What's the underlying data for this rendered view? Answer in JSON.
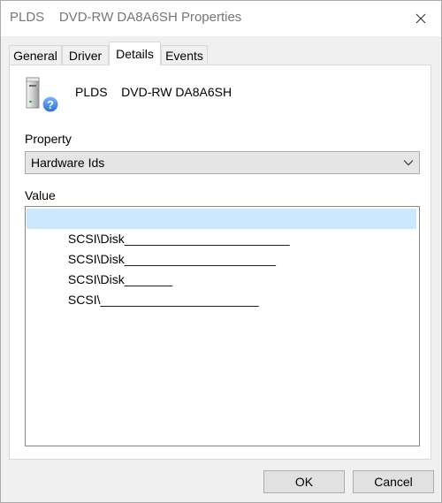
{
  "window": {
    "title": "PLDS    DVD-RW DA8A6SH Properties"
  },
  "tabs": [
    {
      "label": "General",
      "active": false
    },
    {
      "label": "Driver",
      "active": false
    },
    {
      "label": "Details",
      "active": true
    },
    {
      "label": "Events",
      "active": false
    }
  ],
  "device": {
    "name": "PLDS    DVD-RW DA8A6SH",
    "icon": "dvd-drive-unknown-icon"
  },
  "property": {
    "label": "Property",
    "selected": "Hardware Ids"
  },
  "value": {
    "label": "Value",
    "items": [
      {
        "text": "SCSI\\Disk________________________",
        "selected": true
      },
      {
        "text": "SCSI\\Disk______________________",
        "selected": false
      },
      {
        "text": "SCSI\\Disk_______",
        "selected": false
      },
      {
        "text": "SCSI\\_______________________",
        "selected": false
      }
    ]
  },
  "buttons": {
    "ok": "OK",
    "cancel": "Cancel"
  },
  "colors": {
    "selection": "#cce8ff",
    "dialog_bg": "#f0f0f0"
  }
}
